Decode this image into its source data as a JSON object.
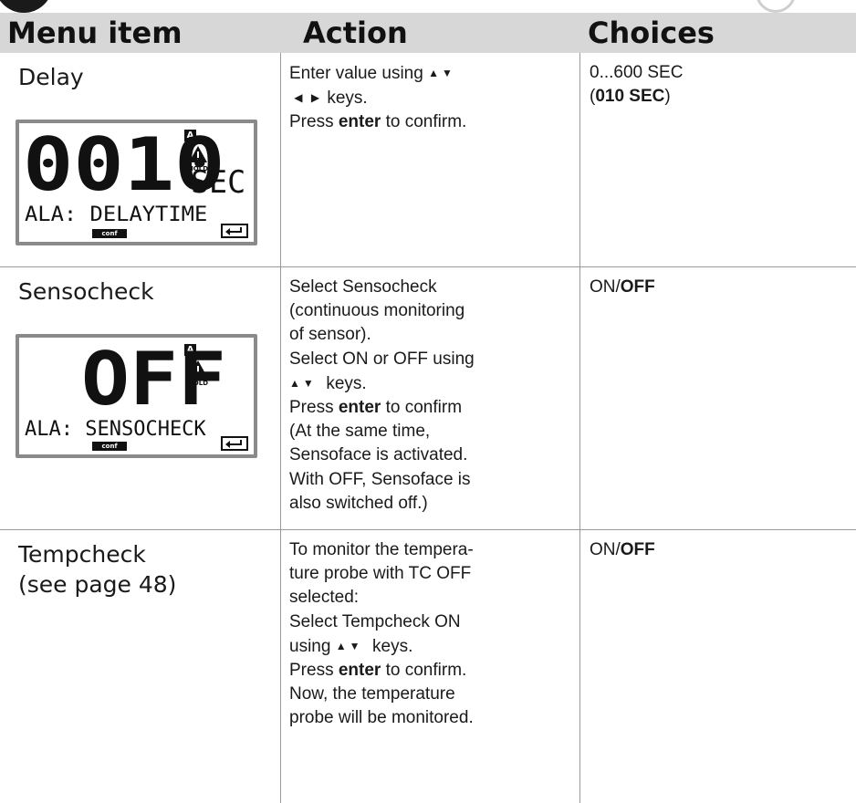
{
  "table": {
    "headers": [
      "Menu item",
      "Action",
      "Choices"
    ],
    "rows": [
      {
        "item": [
          "Delay"
        ],
        "display": {
          "main": "0010",
          "unit": "SEC",
          "line2": "ALA: DELAYTIME",
          "a_label": "A",
          "hold_label": "HOLD",
          "conf_label": "conf"
        },
        "action": [
          "Enter value using ▲ ▼",
          "◀ ▶ keys.",
          "Press enter to confirm."
        ],
        "choices_range": "0...600 SEC",
        "choices_default": "010 SEC"
      },
      {
        "item": [
          "Sensocheck"
        ],
        "display": {
          "main": "OFF",
          "line2": "ALA: SENSOCHECK",
          "a_label": "A",
          "hold_label": "HOLD",
          "conf_label": "conf"
        },
        "action": [
          "Select Sensocheck",
          "(continuous monitoring",
          "of sensor).",
          "Select ON or OFF using",
          "▲ ▼ keys.",
          "Press enter to confirm",
          "(At the same time,",
          "Sensoface is activated.",
          "With OFF, Sensoface is",
          "also switched off.)"
        ],
        "choices_on": "ON/",
        "choices_off": "OFF"
      },
      {
        "item": [
          "Tempcheck",
          "(see page 48)"
        ],
        "action": [
          "To monitor the tempera-",
          "ture probe with TC OFF",
          "selected:",
          "Select Tempcheck ON",
          "using ▲ ▼ keys.",
          "Press enter to confirm.",
          "Now, the temperature",
          "probe will be monitored."
        ],
        "choices_on": "ON/",
        "choices_off": "OFF"
      }
    ]
  },
  "keywords": {
    "enter": "enter"
  },
  "icons": [
    "warning-hold-icon",
    "enter-key-icon",
    "up-down-arrow-keys",
    "left-right-arrow-keys"
  ]
}
